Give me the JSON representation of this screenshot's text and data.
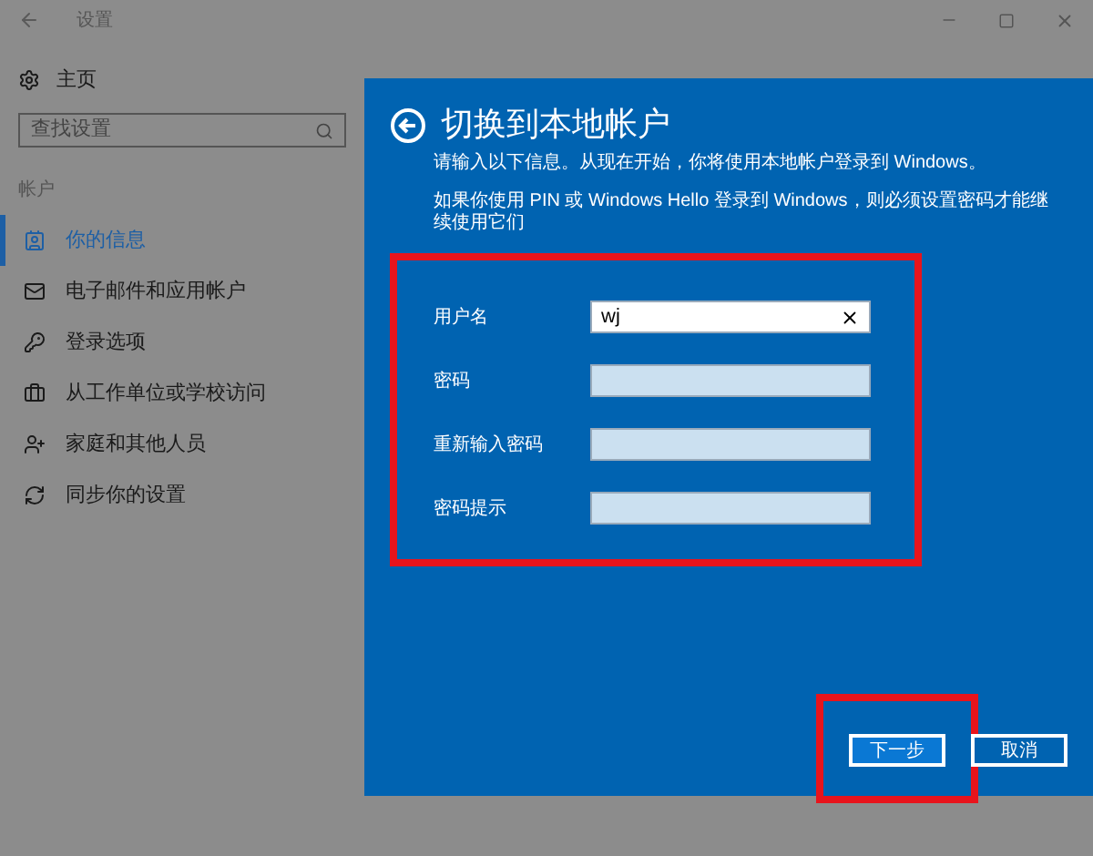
{
  "window": {
    "title": "设置"
  },
  "sidebar": {
    "home": "主页",
    "search": {
      "placeholder": "查找设置"
    },
    "section": "帐户",
    "items": [
      {
        "label": "你的信息",
        "kind": "info",
        "selected": true
      },
      {
        "label": "电子邮件和应用帐户",
        "kind": "mail",
        "selected": false
      },
      {
        "label": "登录选项",
        "kind": "key",
        "selected": false
      },
      {
        "label": "从工作单位或学校访问",
        "kind": "work",
        "selected": false
      },
      {
        "label": "家庭和其他人员",
        "kind": "people",
        "selected": false
      },
      {
        "label": "同步你的设置",
        "kind": "sync",
        "selected": false
      }
    ]
  },
  "dialog": {
    "title": "切换到本地帐户",
    "intro": "请输入以下信息。从现在开始，你将使用本地帐户登录到 Windows。",
    "note": "如果你使用 PIN 或 Windows Hello 登录到 Windows，则必须设置密码才能继续使用它们",
    "form": {
      "highlighted": true,
      "fields": [
        {
          "label": "用户名",
          "value": "wj"
        },
        {
          "label": "密码"
        },
        {
          "label": "重新输入密码"
        },
        {
          "label": "密码提示"
        }
      ]
    },
    "buttons": [
      {
        "label": "下一步",
        "kind": "primary",
        "highlighted": true
      },
      {
        "label": "取消",
        "kind": "secondary",
        "highlighted": false
      }
    ]
  }
}
